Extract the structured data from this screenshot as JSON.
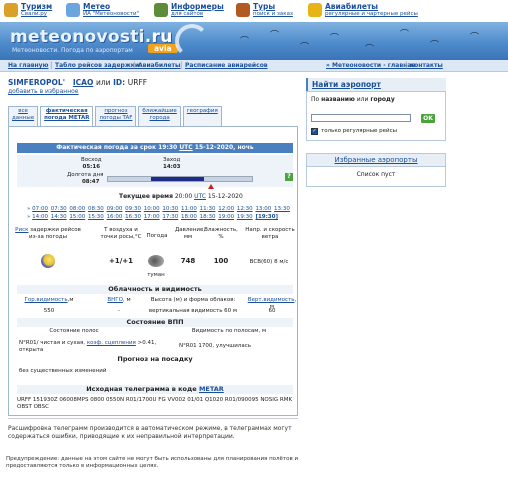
{
  "topbar": {
    "items": [
      {
        "title": "Туризм",
        "sub": "Свали.ру",
        "color": "#d9a12a"
      },
      {
        "title": "Метео",
        "sub": "ИА \"Метеоновости\"",
        "color": "#6aa6dd"
      },
      {
        "title": "Информеры",
        "sub": "для сайтов",
        "color": "#5d8d3b"
      },
      {
        "title": "Туры",
        "sub": "поиск и заказ",
        "color": "#b35a22"
      },
      {
        "title": "Авиабилеты",
        "sub": "регулярные и чартерные рейсы",
        "color": "#e7b416"
      }
    ]
  },
  "banner": {
    "logo": "meteonovosti",
    "logo_domain": ".ru",
    "subtitle": "Метеоновости. Погода по аэропортам",
    "badge": "avia"
  },
  "nav": {
    "links": [
      "На главную",
      "Табло рейсов задержки",
      "Авиабилеты",
      "Расписание авиарейсов"
    ],
    "right_links": [
      "Метеоновости - главная",
      "контакты"
    ]
  },
  "station": {
    "name": "SIMFEROPOL'",
    "icao_label": "ICAO",
    "or_text": "или",
    "id_label": "ID:",
    "id_value": "URFF",
    "fav_link": "добавить в избранное"
  },
  "tabs": [
    {
      "l1": "все",
      "l2": "данные"
    },
    {
      "l1": "фактическая",
      "l2": "погода METAR"
    },
    {
      "l1": "прогноз",
      "l2": "погоды TAF"
    },
    {
      "l1": "ближайшие",
      "l2": "города"
    },
    {
      "l1": "география",
      "l2": ""
    }
  ],
  "actual": {
    "header_pre": "Фактическая погода за срок 19:30",
    "header_utc": "UTC",
    "header_post": "15-12-2020, ночь",
    "sunrise_label": "Восход",
    "sunrise": "05:16",
    "sunset_label": "Заход",
    "sunset": "14:03",
    "daylen_label": "Долгота дня",
    "daylen": "08:47",
    "daylight_fraction": 0.37,
    "current_fraction": 0.72,
    "help": "?",
    "current_label": "Текущее время",
    "current_time": "20:00",
    "current_utc": "UTC",
    "current_date": "15-12-2020",
    "times_row1": [
      "07:00",
      "07:30",
      "08:00",
      "08:30",
      "09:00",
      "09:30",
      "10:00",
      "10:30",
      "11:00",
      "11:30",
      "12:00",
      "12:30",
      "13:00",
      "13:30"
    ],
    "times_row2": [
      "14:00",
      "14:30",
      "15:00",
      "15:30",
      "16:00",
      "16:30",
      "17:00",
      "17:30",
      "18:00",
      "18:30",
      "19:00",
      "19:30",
      "[19:30]"
    ]
  },
  "weather": {
    "risk_link": "Риск",
    "risk_text": "задержки рейсов из-за погоды",
    "col_temp": "T воздуха и точки росы,°С",
    "col_weather": "Погода",
    "col_pressure": "Давление, мм",
    "col_humidity": "Влажность, %",
    "col_wind": "Напр. и скорость ветра",
    "temp": "+1/+1",
    "weather": "туман",
    "pressure": "748",
    "humidity": "100",
    "wind": "ВСВ(60) 8 м/с"
  },
  "clouds": {
    "title": "Облачность и видимость",
    "hvis_link": "Гор.видимость",
    "hvis_unit": ",м",
    "vngo_link": "ВНГО",
    "vngo_unit": ", м",
    "cloud_label": "Высота (м) и форма облаков:",
    "vvis_link": "Верт.видимость",
    "vvis_unit": ", м",
    "hvis": "550",
    "vngo": "-",
    "cloud": "вертикальная видимость 60 м",
    "vvis": "60"
  },
  "runway": {
    "title": "Состояние ВПП",
    "state_label": "Состояние полос",
    "vis_label": "Видимость по полосам, м",
    "state_pre": "N°R01/ чистая и сухая,",
    "state_link": "коэф. сцепления",
    "state_post": ">0.41, открыта",
    "vis_value": "N°R01 1700, улучшилась"
  },
  "landing": {
    "title": "Прогноз на посадку",
    "text": "без существенных изменений"
  },
  "raw": {
    "title_pre": "Исходная телеграмма в коде",
    "title_link": "METAR",
    "text": "URFF 151930Z 06008MPS 0800 0550N R01/1700U FG VV002 01/01 Q1020 R01/090095 NOSIG RMK OBST OBSC"
  },
  "decode_note": "Расшифровка телеграмм производится в автоматическом режиме, в телеграммах могут содержаться ошибки, приводящие к их неправильной интерпретации.",
  "footer": "Предупреждение: данные на этом сайте не могут быть использованы для планирования полётов и предоставляются только в информационных целях.",
  "sidebar": {
    "find_title": "Найти аэропорт",
    "find_hint_pre": "По",
    "find_hint_b1": "названию",
    "find_hint_mid": "или",
    "find_hint_b2": "городу",
    "ok": "OK",
    "regular": "только регулярные рейсы",
    "fav_title": "Избранные аэропорты",
    "fav_empty": "Список пуст"
  }
}
